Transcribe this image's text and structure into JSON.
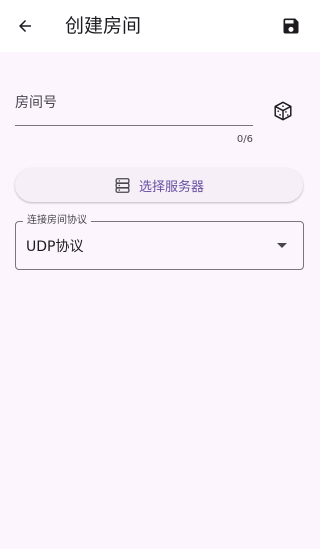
{
  "appbar": {
    "title": "创建房间"
  },
  "room_field": {
    "label": "房间号",
    "value": "",
    "counter": "0/6"
  },
  "server_button": {
    "label": "选择服务器"
  },
  "protocol_field": {
    "label": "连接房间协议",
    "value": "UDP协议"
  },
  "colors": {
    "accent": "#6750a4",
    "background": "#fcf5fd",
    "text": "#1d1b20"
  },
  "icons": [
    "back-arrow-icon",
    "save-icon",
    "dice-icon",
    "server-icon",
    "dropdown-arrow-icon"
  ]
}
